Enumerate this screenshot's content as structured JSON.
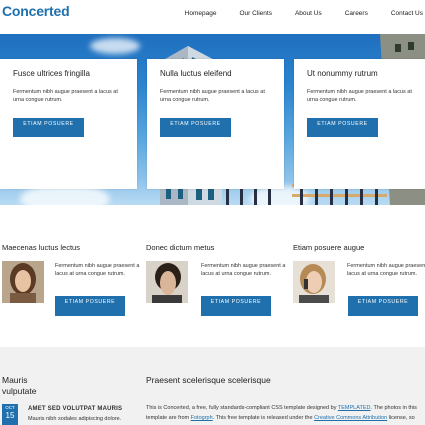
{
  "header": {
    "logo": "Concerted",
    "nav": [
      "Homepage",
      "Our Clients",
      "About Us",
      "Careers",
      "Contact Us"
    ]
  },
  "hero_cards": [
    {
      "title": "Fusce ultrices fringilla",
      "text": "Fermentum nibh augue praesent a lacus at urna congue rutrum.",
      "button": "Etiam posuere"
    },
    {
      "title": "Nulla luctus eleifend",
      "text": "Fermentum nibh augue praesent a lacus at urna congue rutrum.",
      "button": "Etiam posuere"
    },
    {
      "title": "Ut nonummy rutrum",
      "text": "Fermentum nibh augue praesent a lacus at urna congue rutrum.",
      "button": "Etiam posuere"
    }
  ],
  "features": [
    {
      "title": "Maecenas luctus lectus",
      "text": "Fermentum nibh augue praesent a lacus at urna congue rutrum.",
      "button": "Etiam posuere"
    },
    {
      "title": "Donec dictum metus",
      "text": "Fermentum nibh augue praesent a lacus at urna congue rutrum.",
      "button": "Etiam posuere"
    },
    {
      "title": "Etiam posuere augue",
      "text": "Fermentum nibh augue praesent a lacus at urna congue rutrum.",
      "button": "Etiam posuere"
    }
  ],
  "bottom": {
    "left_title": "Mauris vulputate",
    "event": {
      "month": "OCT",
      "day": "15",
      "title": "AMET SED VOLUTPAT MAURIS",
      "desc": "Mauris nibh sodales adipiscing dolore."
    },
    "mid_title": "Praesent scelerisque scelerisque",
    "mid_line1_a": "This is Concerted, a free, fully standards-compliant CSS template designed by ",
    "mid_line1_link": "TEMPLATED",
    "mid_line1_b": ". The photos in this",
    "mid_line2_a": "template are from ",
    "mid_line2_link": "Fotogrph",
    "mid_line2_b": ". This free template is released under the ",
    "mid_line2_link2": "Creative Commons Attribution",
    "mid_line2_c": " license, so"
  },
  "colors": {
    "accent": "#1f70ad"
  }
}
